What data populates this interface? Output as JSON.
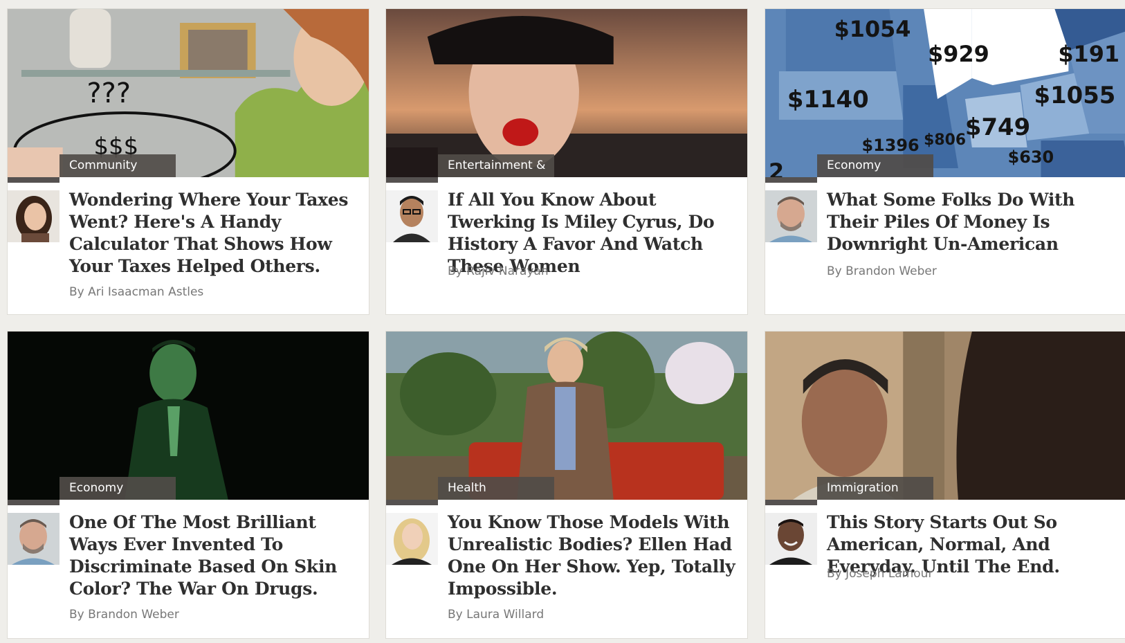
{
  "articles": [
    {
      "category": "Community",
      "title": "Wondering Where Your Taxes Went? Here's A Handy Calculator That Shows How Your Taxes Helped Others.",
      "byline": "By Ari Isaacman Astles",
      "image_text": [
        "???",
        "$$$"
      ],
      "colors": {
        "image_bg": "#b9bbb8"
      }
    },
    {
      "category": "Entertainment & Culture",
      "title": "If All You Know About Twerking Is Miley Cyrus, Do History A Favor And Watch These Women",
      "byline": "By Rajiv Narayan",
      "colors": {
        "image_bg": "#7d5a48"
      }
    },
    {
      "category": "Economy",
      "title": "What Some Folks Do With Their Piles Of Money Is Downright Un-American",
      "byline": "By Brandon Weber",
      "image_text": [
        "$1054",
        "$929",
        "$191",
        "$1140",
        "$1055",
        "$749",
        "$1396",
        "$806",
        "$630",
        "2"
      ],
      "colors": {
        "image_bg": "#5d86b8"
      }
    },
    {
      "category": "Economy",
      "title": "One Of The Most Brilliant Ways Ever Invented To Discriminate Based On Skin Color? The War On Drugs.",
      "byline": "By Brandon Weber",
      "colors": {
        "image_bg": "#050805"
      }
    },
    {
      "category": "Health",
      "title": "You Know Those Models With Unrealistic Bodies? Ellen Had One On Her Show. Yep, Totally Impossible.",
      "byline": "By Laura Willard",
      "colors": {
        "image_bg": "#6e8a5a"
      }
    },
    {
      "category": "Immigration",
      "title": "This Story Starts Out So American, Normal, And Everyday. Until The End.",
      "byline": "By Joseph Lamour",
      "colors": {
        "image_bg": "#a08668"
      }
    }
  ]
}
